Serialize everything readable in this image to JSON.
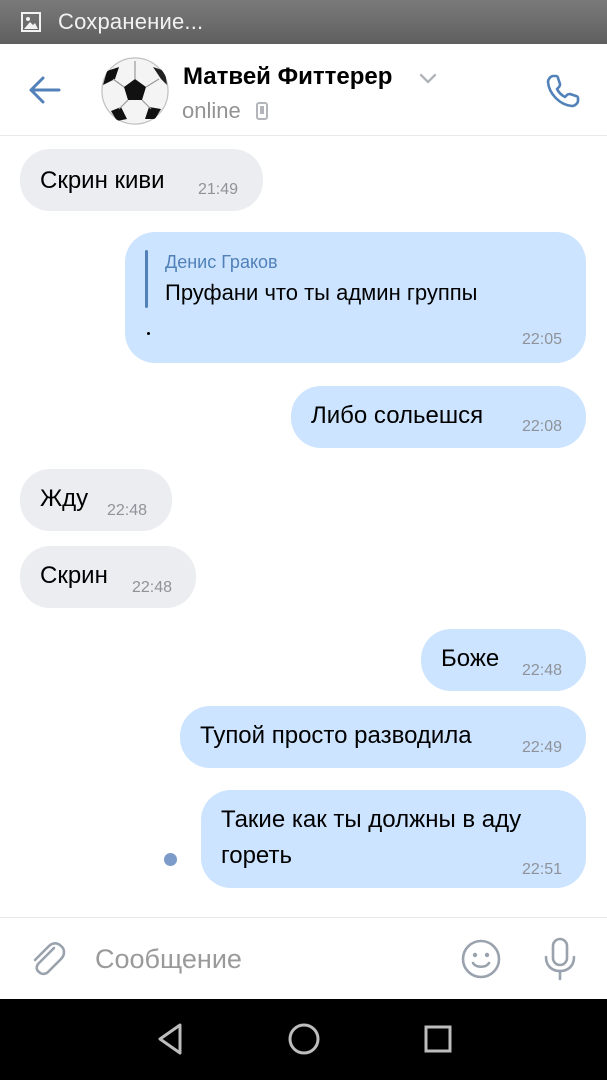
{
  "status_bar": {
    "text": "Сохранение...",
    "icon": "image-save-icon"
  },
  "header": {
    "name": "Матвей Фиттерер",
    "status": "online",
    "icons": {
      "back": "arrow-left-icon",
      "call": "phone-icon",
      "device": "mobile-icon",
      "dropdown": "chevron-down-icon"
    }
  },
  "messages": [
    {
      "direction": "in",
      "text": "Скрин киви",
      "time": "21:49"
    },
    {
      "direction": "out",
      "reply_to": {
        "author": "Денис Граков",
        "text": "Пруфани что ты админ группы"
      },
      "text": ".",
      "time": "22:05"
    },
    {
      "direction": "out",
      "text": "Либо сольешся",
      "time": "22:08"
    },
    {
      "direction": "in",
      "text": "Жду",
      "time": "22:48"
    },
    {
      "direction": "in",
      "text": "Скрин",
      "time": "22:48"
    },
    {
      "direction": "out",
      "text": "Боже",
      "time": "22:48"
    },
    {
      "direction": "out",
      "text": "Тупой просто разводила",
      "time": "22:49"
    },
    {
      "direction": "out",
      "text_lines": [
        "Такие как ты должны в аду",
        "гореть"
      ],
      "time": "22:51",
      "unread": true
    }
  ],
  "composer": {
    "placeholder": "Сообщение",
    "icons": {
      "attach": "paperclip-icon",
      "emoji": "smiley-icon",
      "mic": "microphone-icon"
    }
  },
  "navbar": {
    "icons": [
      "back-triangle-icon",
      "home-circle-icon",
      "recents-square-icon"
    ]
  },
  "colors": {
    "accent": "#5181b8",
    "incoming_bubble": "#ebedf0",
    "outgoing_bubble": "#cce4ff",
    "time": "#8f9399",
    "unread_dot": "#7d9bc9"
  }
}
